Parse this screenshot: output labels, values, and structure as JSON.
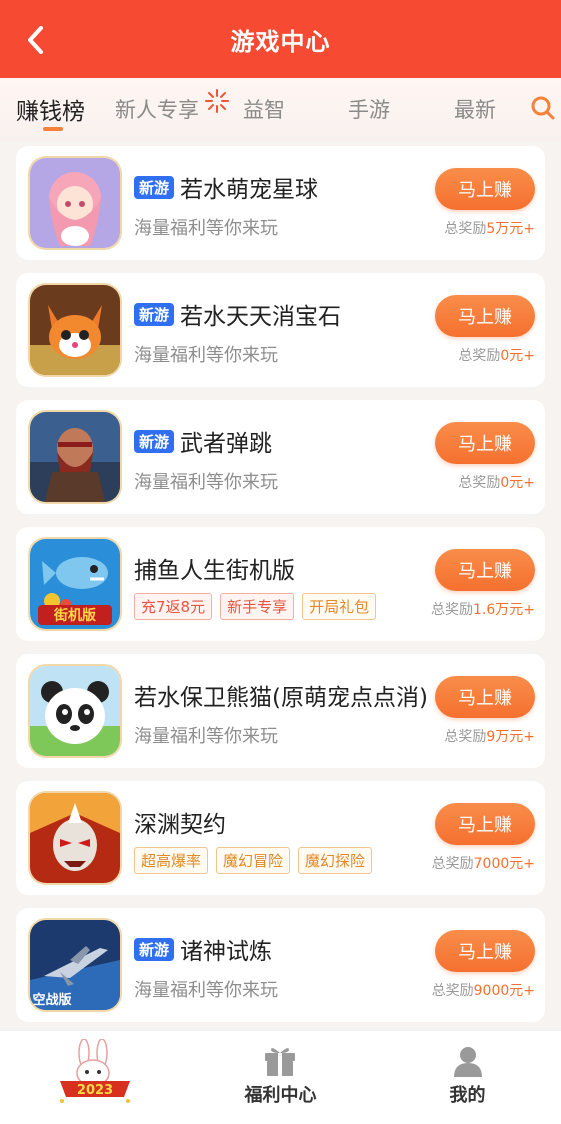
{
  "header": {
    "title": "游戏中心"
  },
  "tabs": [
    {
      "label": "赚钱榜",
      "active": true
    },
    {
      "label": "新人专享"
    },
    {
      "label": "益智"
    },
    {
      "label": "手游"
    },
    {
      "label": "最新"
    }
  ],
  "games": [
    {
      "title": "若水萌宠星球",
      "is_new": true,
      "new_label": "新游",
      "subtitle": "海量福利等你来玩",
      "tags": [],
      "button": "马上赚",
      "reward_prefix": "总奖励",
      "reward_amount": "5万元+"
    },
    {
      "title": "若水天天消宝石",
      "is_new": true,
      "new_label": "新游",
      "subtitle": "海量福利等你来玩",
      "tags": [],
      "button": "马上赚",
      "reward_prefix": "总奖励",
      "reward_amount": "0元+"
    },
    {
      "title": "武者弹跳",
      "is_new": true,
      "new_label": "新游",
      "subtitle": "海量福利等你来玩",
      "tags": [],
      "button": "马上赚",
      "reward_prefix": "总奖励",
      "reward_amount": "0元+"
    },
    {
      "title": "捕鱼人生街机版",
      "is_new": false,
      "subtitle": "",
      "tags": [
        {
          "text": "充7返8元",
          "color": "red"
        },
        {
          "text": "新手专享",
          "color": "red"
        },
        {
          "text": "开局礼包",
          "color": "orange"
        }
      ],
      "button": "马上赚",
      "reward_prefix": "总奖励",
      "reward_amount": "1.6万元+"
    },
    {
      "title": "若水保卫熊猫(原萌宠点点消)",
      "is_new": false,
      "subtitle": "海量福利等你来玩",
      "tags": [],
      "button": "马上赚",
      "reward_prefix": "总奖励",
      "reward_amount": "9万元+"
    },
    {
      "title": "深渊契约",
      "is_new": false,
      "subtitle": "",
      "tags": [
        {
          "text": "超高爆率",
          "color": "orange"
        },
        {
          "text": "魔幻冒险",
          "color": "orange"
        },
        {
          "text": "魔幻探险",
          "color": "orange"
        }
      ],
      "button": "马上赚",
      "reward_prefix": "总奖励",
      "reward_amount": "7000元+"
    },
    {
      "title": "诸神试炼",
      "is_new": true,
      "new_label": "新游",
      "subtitle": "海量福利等你来玩",
      "tags": [],
      "button": "马上赚",
      "reward_prefix": "总奖励",
      "reward_amount": "9000元+"
    }
  ],
  "thumb_labels": {
    "fishing": "街机版",
    "jet": "空战版"
  },
  "bottom_nav": [
    {
      "label": "",
      "icon": "rabbit-2023-icon",
      "badge": "2023"
    },
    {
      "label": "福利中心",
      "icon": "gift-icon"
    },
    {
      "label": "我的",
      "icon": "user-icon"
    }
  ],
  "colors": {
    "header": "#f64a33",
    "accent": "#f5702f",
    "new_badge": "#2f6ff0"
  }
}
